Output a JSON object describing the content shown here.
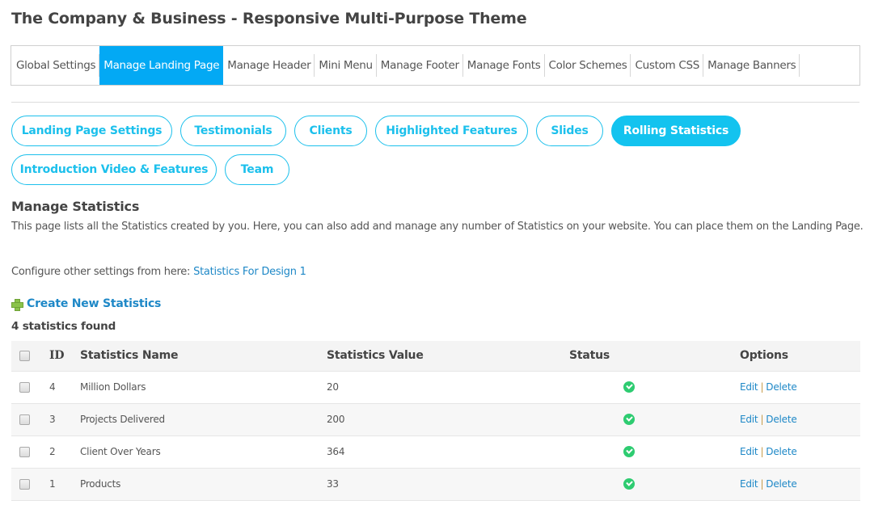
{
  "page": {
    "title": "The Company & Business - Responsive Multi-Purpose Theme"
  },
  "main_nav": {
    "items": [
      {
        "label": "Global Settings",
        "active": false
      },
      {
        "label": "Manage Landing Page",
        "active": true
      },
      {
        "label": "Manage Header",
        "active": false
      },
      {
        "label": "Mini Menu",
        "active": false
      },
      {
        "label": "Manage Footer",
        "active": false
      },
      {
        "label": "Manage Fonts",
        "active": false
      },
      {
        "label": "Color Schemes",
        "active": false
      },
      {
        "label": "Custom CSS",
        "active": false
      },
      {
        "label": "Manage Banners",
        "active": false
      }
    ]
  },
  "sub_nav": {
    "items": [
      {
        "label": "Landing Page Settings",
        "active": false
      },
      {
        "label": "Testimonials",
        "active": false
      },
      {
        "label": "Clients",
        "active": false
      },
      {
        "label": "Highlighted Features",
        "active": false
      },
      {
        "label": "Slides",
        "active": false
      },
      {
        "label": "Rolling Statistics",
        "active": true
      },
      {
        "label": "Introduction Video & Features",
        "active": false
      },
      {
        "label": "Team",
        "active": false
      }
    ]
  },
  "section": {
    "title": "Manage Statistics",
    "description": "This page lists all the Statistics created by you. Here, you can also add and manage any number of Statistics on your website. You can place them on the Landing Page.",
    "configure_prefix": "Configure other settings from here: ",
    "configure_link": "Statistics For Design 1",
    "create_label": "Create New Statistics",
    "create_icon": "plus-icon",
    "count_text": "4 statistics found"
  },
  "table": {
    "headers": {
      "id": "ID",
      "name": "Statistics Name",
      "value": "Statistics Value",
      "status": "Status",
      "options": "Options"
    },
    "rows": [
      {
        "id": "4",
        "name": "Million Dollars",
        "value": "20",
        "status": "active",
        "edit": "Edit",
        "sep": "|",
        "delete": "Delete"
      },
      {
        "id": "3",
        "name": "Projects Delivered",
        "value": "200",
        "status": "active",
        "edit": "Edit",
        "sep": "|",
        "delete": "Delete"
      },
      {
        "id": "2",
        "name": "Client Over Years",
        "value": "364",
        "status": "active",
        "edit": "Edit",
        "sep": "|",
        "delete": "Delete"
      },
      {
        "id": "1",
        "name": "Products",
        "value": "33",
        "status": "active",
        "edit": "Edit",
        "sep": "|",
        "delete": "Delete"
      }
    ]
  },
  "colors": {
    "accent": "#03a9f4",
    "pill": "#1cc0ec",
    "link": "#1e88c7",
    "status_ok": "#2ecc71"
  }
}
